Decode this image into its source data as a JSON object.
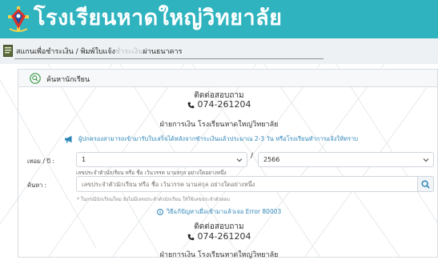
{
  "header": {
    "title": "โรงเรียนหาดใหญ่วิทยาลัย",
    "bg_color": "#2fb3bf",
    "logo_icon": "school-emblem-icon"
  },
  "breadcrumb": {
    "text_main": "สแกนเพื่อชำระเงิน / พิมพ์ใบแจ้ง",
    "text_faded": "ชำระเงิน",
    "text_tail": "ผ่านธนาคาร",
    "icon": "document-icon"
  },
  "card": {
    "title": "ค้นหานักเรียน",
    "icon": "search-circle-icon"
  },
  "contact_top": {
    "heading": "ติดต่อสอบถาม",
    "phone": "074-261204",
    "department": "ฝ่ายการเงิน โรงเรียนหาดใหญ่วิทยาลัย"
  },
  "notice": {
    "text": "ผู้ปกครองสามารถเข้ามารับใบเสร็จได้หลังจากชำระเงินแล้วประมาณ 2-3 วัน หรือโรงเรียนทำการแจ้งให้ทราบ",
    "icon": "megaphone-icon",
    "color": "#2f86b8"
  },
  "term": {
    "label": "เทอม / ปี :",
    "term_value": "1",
    "separator": "/",
    "year_value": "2566",
    "help": "เลขประจำตัวนักเรียน หรือ ชื่อ เว้นวรรค นามสกุล อย่างใดอย่างหนึ่ง"
  },
  "search": {
    "label": "ค้นหา :",
    "placeholder": "เลขประจำตัวนักเรียน หรือ ชื่อ เว้นวรรค นามสกุล อย่างใดอย่างหนึ่ง",
    "hint": "* ในกรณีนักเรียนใหม่ ยังไม่มีเลขประจำตัวนักเรียน ให้ใช้เลขประจำตัวสอบ",
    "button_icon": "magnifier-icon"
  },
  "error_link": {
    "text": "วิธีแก้ปัญหาเมื่อเข้ามาแล้วเจอ Error 80003",
    "icon": "info-icon"
  },
  "contact_bottom": {
    "heading": "ติดต่อสอบถาม",
    "phone": "074-261204",
    "department": "ฝ่ายการเงิน โรงเรียนหาดใหญ่วิทยาลัย"
  }
}
